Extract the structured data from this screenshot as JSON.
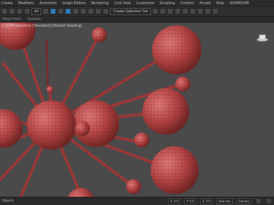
{
  "menu": [
    "Create",
    "Modifiers",
    "Animation",
    "Graph Editors",
    "Rendering",
    "Civil View",
    "Customize",
    "Scripting",
    "Content",
    "Arnold",
    "Help",
    "3DXMOUSE"
  ],
  "toolbar": {
    "selection_filter": "All",
    "view_dropdown": "Create Selection Set"
  },
  "tabs": [
    "Object Paint",
    "Populate"
  ],
  "viewport": {
    "label": "[+] [Perspective] [Standard] [Default Shading]"
  },
  "statusbar": {
    "left_label": "Objects",
    "coord_x": "X: 0.0",
    "coord_y": "Y: 0.0",
    "coord_z": "Z: 0.0",
    "auto_key": "Auto Key",
    "set_key": "Set Key"
  },
  "colors": {
    "accent": "#2f7fbf",
    "sphere": "#b54444",
    "viewport": "#4a4a4a"
  }
}
